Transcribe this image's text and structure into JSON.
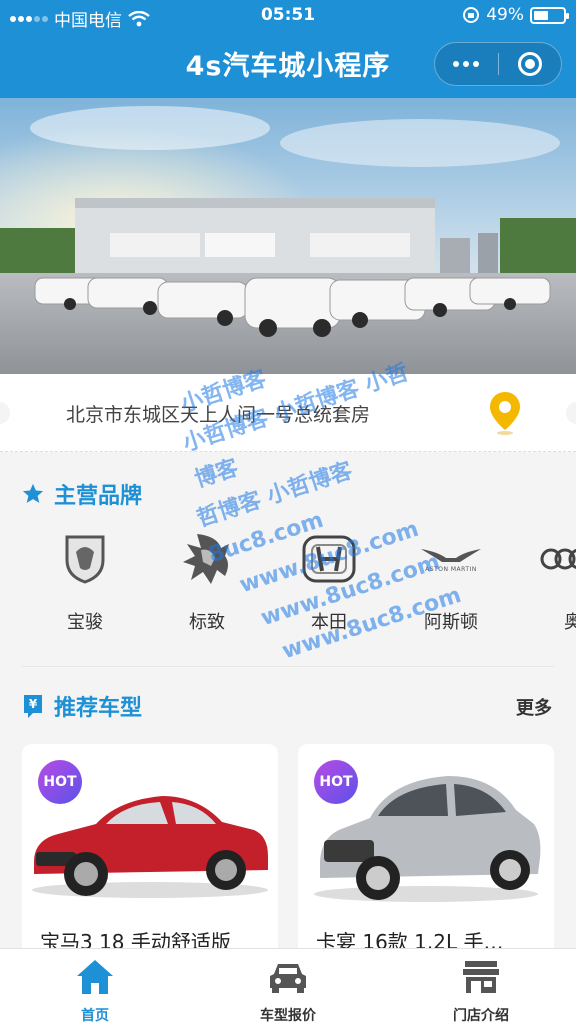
{
  "status_bar": {
    "carrier": "中国电信",
    "time": "05:51",
    "battery": "49%",
    "battery_level": 0.49
  },
  "nav": {
    "title": "4s汽车城小程序"
  },
  "address": {
    "text": "北京市东城区天上人间一号总统套房"
  },
  "brands_section": {
    "title": "主营品牌",
    "items": [
      {
        "name": "宝骏",
        "icon": "baojun-logo-icon"
      },
      {
        "name": "标致",
        "icon": "peugeot-logo-icon"
      },
      {
        "name": "本田",
        "icon": "honda-logo-icon"
      },
      {
        "name": "阿斯顿",
        "icon": "aston-martin-logo-icon"
      },
      {
        "name": "奥",
        "icon": "audi-logo-icon"
      }
    ],
    "aston_wordmark": "ASTON MARTIN"
  },
  "recommend_section": {
    "title": "推荐车型",
    "more": "更多",
    "badge_icon": "yuan-badge-icon"
  },
  "cars": [
    {
      "title": "宝马3 18 手动舒适版",
      "badge": "HOT",
      "color": "#c4202c"
    },
    {
      "title": "卡宴 16款 1.2L 手…",
      "badge": "HOT",
      "color": "#b9bcc0"
    }
  ],
  "tabbar": {
    "items": [
      {
        "label": "首页",
        "icon": "home-icon",
        "active": true
      },
      {
        "label": "车型报价",
        "icon": "car-icon",
        "active": false
      },
      {
        "label": "门店介绍",
        "icon": "store-icon",
        "active": false
      }
    ]
  },
  "watermark": {
    "lines": [
      "小哲博客",
      "小哲博客 小哲博客 小哲博客",
      "哲博客 小哲博客 8uc8.com",
      "www.8uc8.com",
      "www.8uc8.com",
      "www.8uc8.com"
    ]
  },
  "colors": {
    "accent": "#1e90d6",
    "hot_badge": "#7b4fe6",
    "pin": "#f5b800"
  }
}
